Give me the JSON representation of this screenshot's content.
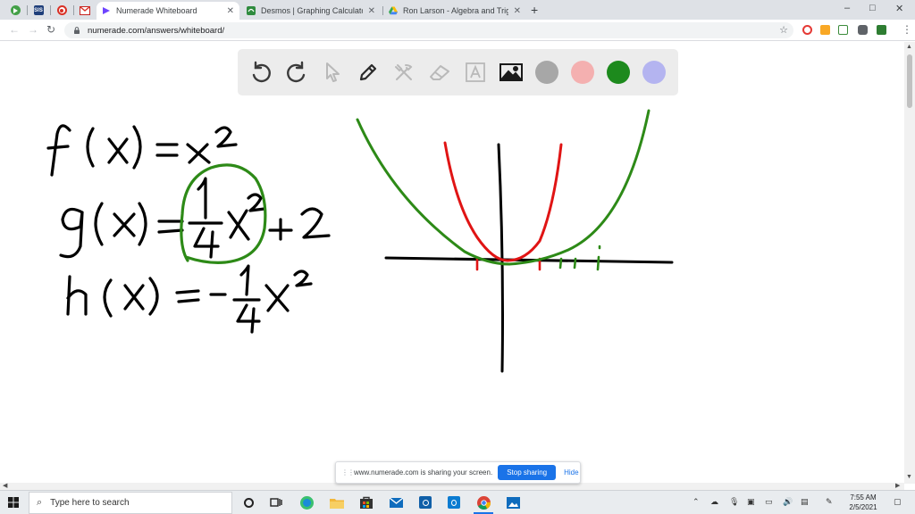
{
  "browser": {
    "pinned_tabs": [
      {
        "icon": "play-store-icon",
        "color": "#43a047"
      },
      {
        "icon": "sis-icon",
        "color": "#1f3f7a",
        "text": "SIS"
      },
      {
        "icon": "record-icon",
        "color": "#d93025"
      },
      {
        "icon": "gmail-icon",
        "color": "#ffffff"
      }
    ],
    "tabs": [
      {
        "title": "Numerade Whiteboard",
        "icon": "numerade-icon",
        "active": true
      },
      {
        "title": "Desmos | Graphing Calculator",
        "icon": "desmos-icon",
        "active": false
      },
      {
        "title": "Ron Larson - Algebra and Trigono",
        "icon": "google-drive-icon",
        "active": false
      }
    ],
    "new_tab_label": "+",
    "window_controls": {
      "minimize": "–",
      "maximize": "□",
      "close": "✕"
    },
    "url": "numerade.com/answers/whiteboard/"
  },
  "whiteboard": {
    "tools": [
      "undo-icon",
      "redo-icon",
      "pointer-icon",
      "pen-icon",
      "tools-icon",
      "eraser-icon",
      "text-tool-icon",
      "image-icon"
    ],
    "colors": [
      "#a7a7a7",
      "#f4b0b0",
      "#1d8a1d",
      "#b4b4f0"
    ],
    "ink": {
      "black": "#000000",
      "green": "#2d8a17",
      "red": "#e01414"
    }
  },
  "share_notice": {
    "message": "www.numerade.com is sharing your screen.",
    "stop_label": "Stop sharing",
    "hide_label": "Hide"
  },
  "taskbar": {
    "search_placeholder": "Type here to search",
    "time": "7:55 AM",
    "date": "2/5/2021"
  }
}
